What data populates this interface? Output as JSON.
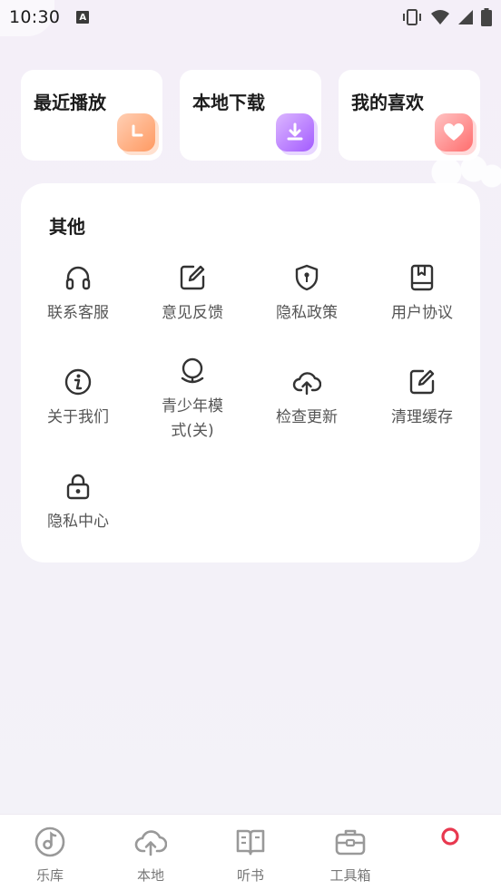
{
  "status_bar": {
    "time": "10:30",
    "notification_icon_letter": "A",
    "icons": [
      "vibrate-icon",
      "wifi-icon",
      "signal-icon",
      "battery-icon"
    ]
  },
  "shortcuts": [
    {
      "label": "最近播放",
      "icon": "clock-icon",
      "color": "#ff9a62"
    },
    {
      "label": "本地下载",
      "icon": "download-icon",
      "color": "#a35bff"
    },
    {
      "label": "我的喜欢",
      "icon": "heart-icon",
      "color": "#ff6e6e"
    }
  ],
  "other": {
    "title": "其他",
    "items": [
      {
        "label": "联系客服",
        "icon": "headphones-icon"
      },
      {
        "label": "意见反馈",
        "icon": "edit-icon"
      },
      {
        "label": "隐私政策",
        "icon": "shield-icon"
      },
      {
        "label": "用户协议",
        "icon": "book-icon"
      },
      {
        "label": "关于我们",
        "icon": "info-icon"
      },
      {
        "label": "青少年模\n式(关)",
        "icon": "youth-mode-icon"
      },
      {
        "label": "检查更新",
        "icon": "cloud-upload-icon"
      },
      {
        "label": "清理缓存",
        "icon": "edit-icon"
      },
      {
        "label": "隐私中心",
        "icon": "lock-icon"
      }
    ]
  },
  "bottom_nav": {
    "items": [
      {
        "label": "乐库",
        "icon": "music-disc-icon"
      },
      {
        "label": "本地",
        "icon": "cloud-icon"
      },
      {
        "label": "听书",
        "icon": "open-book-icon"
      },
      {
        "label": "工具箱",
        "icon": "toolbox-icon"
      },
      {
        "label": "",
        "icon": "ring-icon",
        "active_color": "#e8384f"
      }
    ]
  }
}
